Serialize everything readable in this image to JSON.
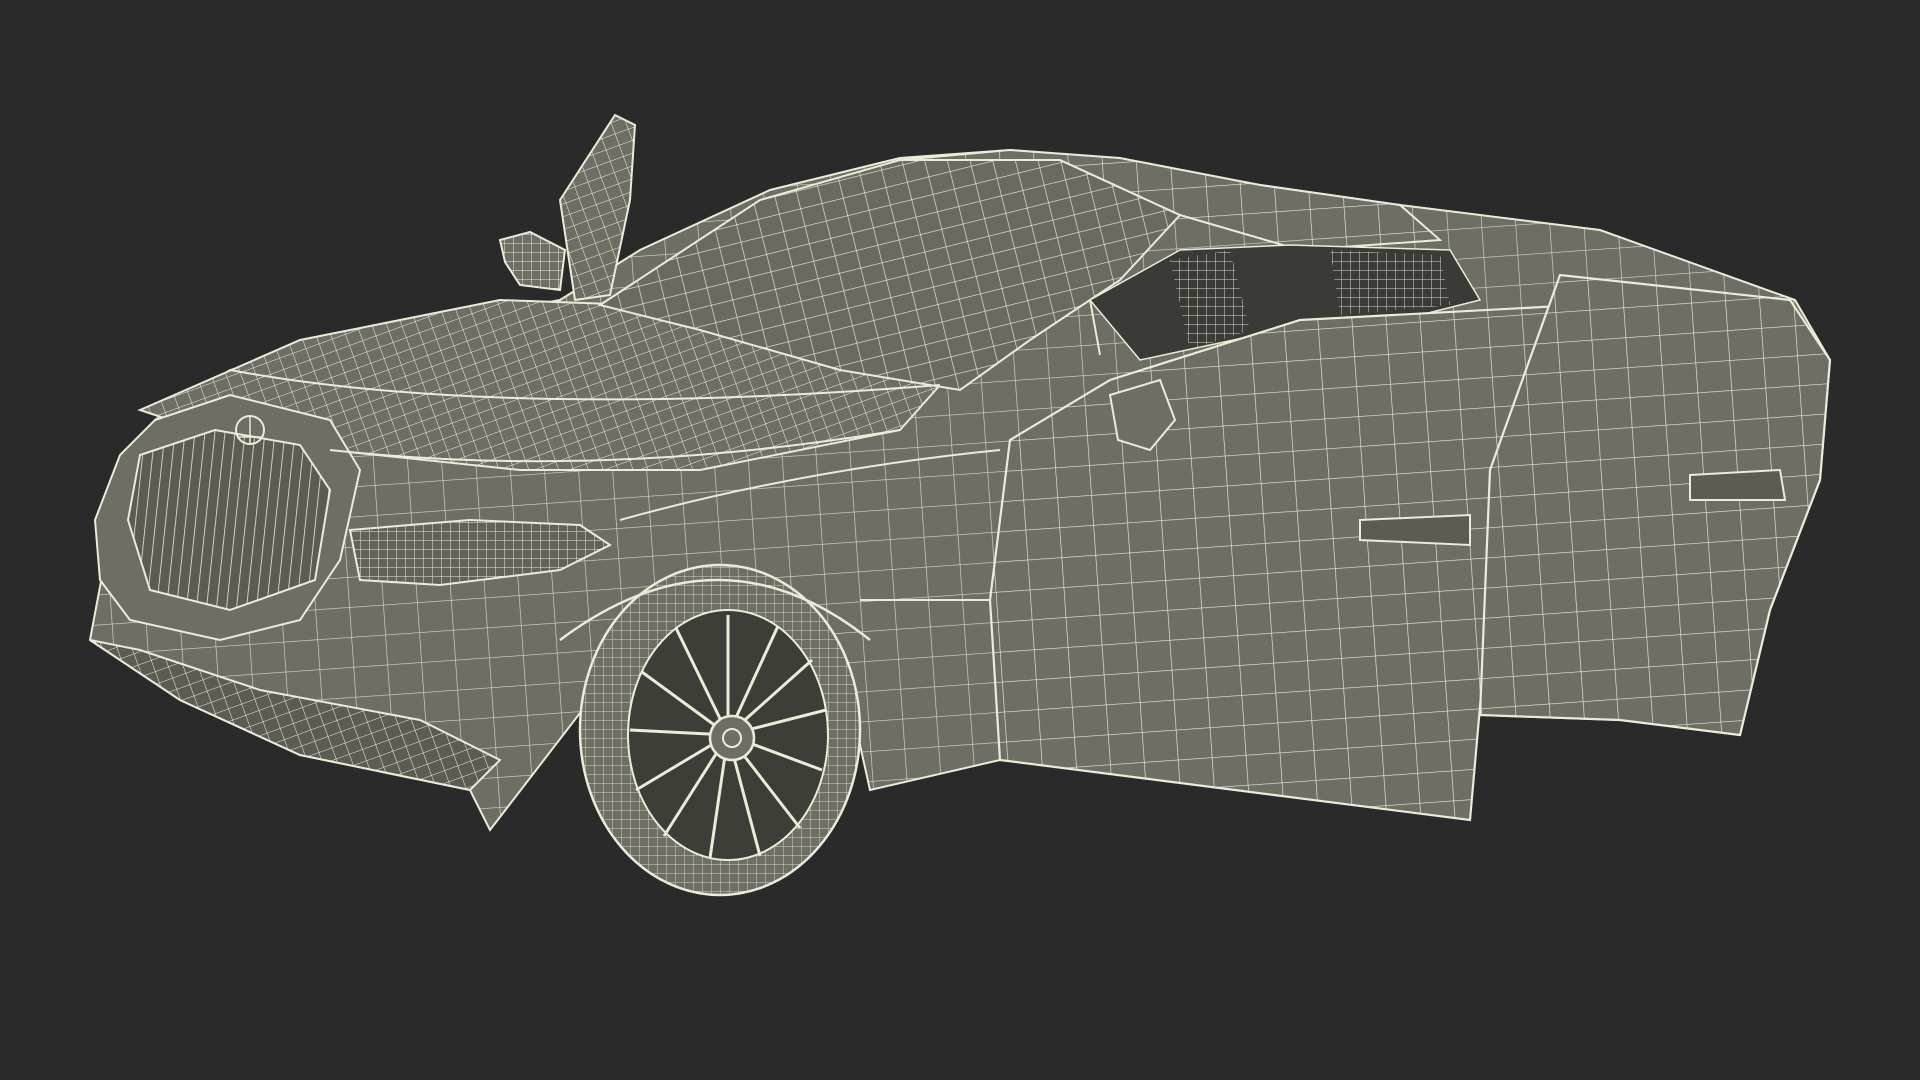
{
  "scene": {
    "subject": "sedan-wireframe-render",
    "background_color": "#2a2a2a",
    "mesh_fill_color": "#6e6e64",
    "mesh_dark_fill_color": "#5c5c53",
    "wire_color": "#ecead8",
    "state": {
      "driver_door": "open",
      "rear_door": "open"
    }
  }
}
